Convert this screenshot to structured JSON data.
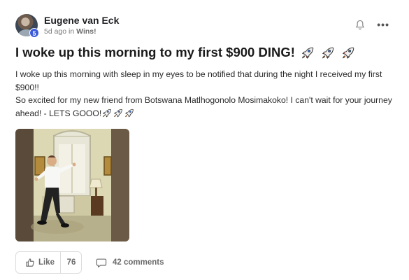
{
  "post": {
    "author": "Eugene van Eck",
    "level": "5",
    "meta_time": "5d ago in ",
    "meta_category": "Wins!",
    "title": "I woke up this morning to my first $900 DING!",
    "body_line1": "I woke up this morning with sleep in my eyes to be notified that during the night I received my first $900!!",
    "body_line2": "So excited for my new friend from Botswana Matlhogonolo Mosimakoko! I can't wait for your journey ahead! - LETS GOOO!",
    "title_rocket_count": 3,
    "body_rocket_count": 3
  },
  "header_icons": {
    "notify_icon": "bell-icon",
    "more_icon": "ellipsis-icon",
    "more_label": "•••"
  },
  "actions": {
    "like_label": "Like",
    "like_count": "76",
    "comments_label": "42 comments",
    "like_icon": "thumbs-up-icon",
    "comment_icon": "comment-icon"
  },
  "colors": {
    "level_badge": "#3b5bdb",
    "rocket_body": "#f1f1f1",
    "rocket_accent": "#2f6fe4",
    "rocket_flame": "#ff8a1f"
  }
}
